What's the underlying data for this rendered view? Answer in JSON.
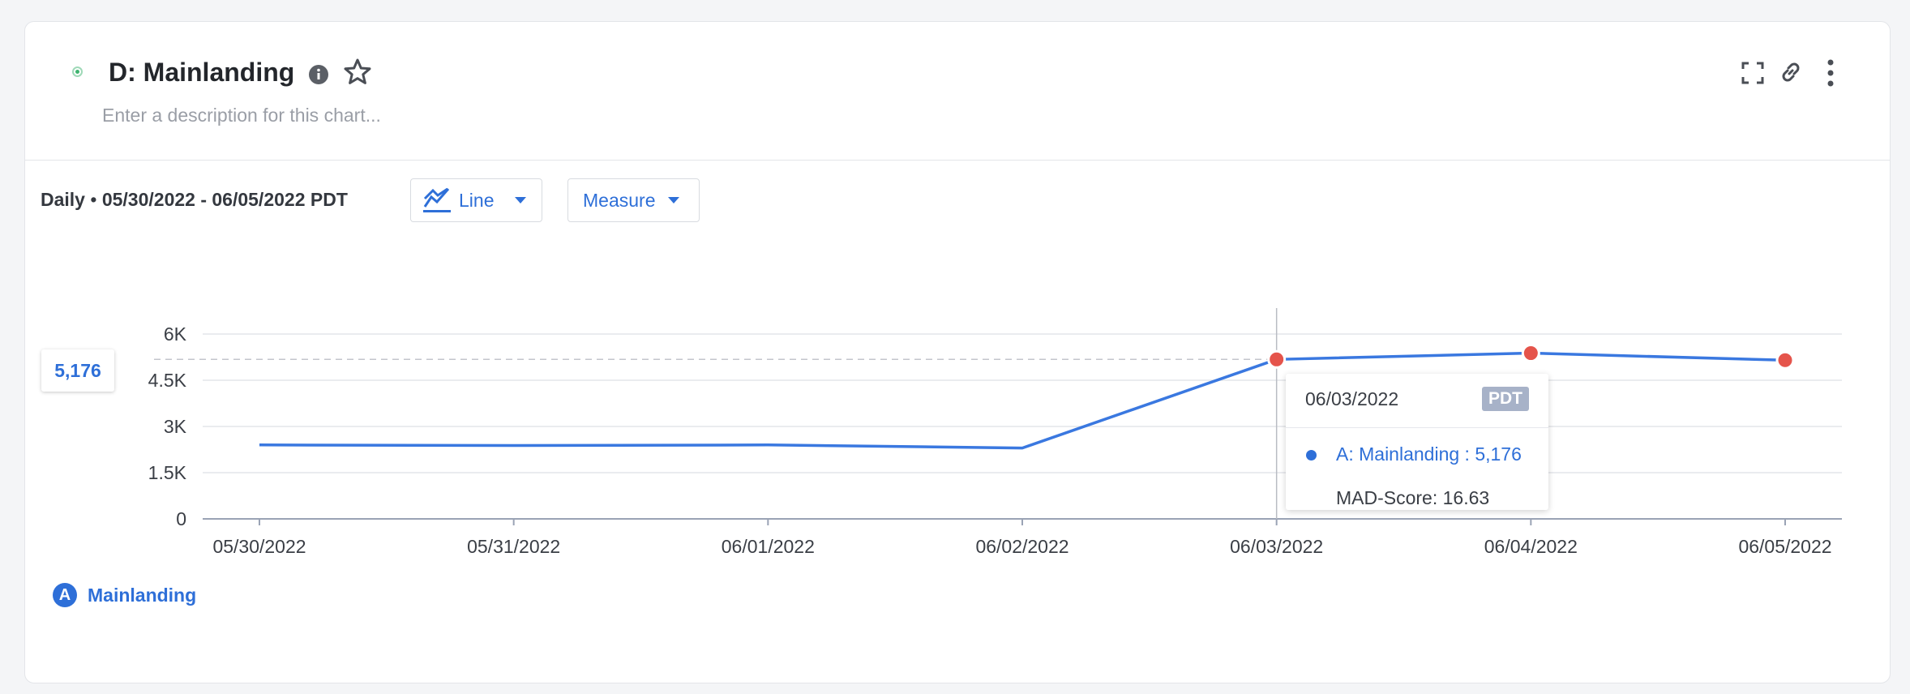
{
  "header": {
    "title": "D: Mainlanding",
    "description_placeholder": "Enter a description for this chart..."
  },
  "controls": {
    "granularity": "Daily",
    "separator": "•",
    "date_range": "05/30/2022 - 06/05/2022 PDT",
    "chart_type_label": "Line",
    "measure_label": "Measure"
  },
  "icons": {
    "status": "status-dot-icon",
    "info": "info-icon",
    "favorite": "star-icon",
    "expand": "expand-icon",
    "link": "link-icon",
    "more": "more-vertical-icon",
    "chart_type": "line-chart-icon"
  },
  "colors": {
    "accent": "#2e6fd8",
    "series_line": "#3a78e0",
    "anomaly_point": "#e5544b",
    "status": "#3fb46f",
    "tooltip_tz_badge": "#a7b2c8"
  },
  "hover_value_label": "5,176",
  "tooltip": {
    "date": "06/03/2022",
    "tz": "PDT",
    "series_text": "A: Mainlanding : 5,176",
    "score_text": "MAD-Score: 16.63"
  },
  "legend": {
    "badge": "A",
    "label": "Mainlanding"
  },
  "chart_data": {
    "type": "line",
    "x": [
      "05/30/2022",
      "05/31/2022",
      "06/01/2022",
      "06/02/2022",
      "06/03/2022",
      "06/04/2022",
      "06/05/2022"
    ],
    "series": [
      {
        "name": "Mainlanding",
        "values": [
          2400,
          2380,
          2400,
          2300,
          5176,
          5380,
          5150
        ]
      }
    ],
    "anomalies": [
      "06/03/2022",
      "06/04/2022",
      "06/05/2022"
    ],
    "ylim": [
      0,
      6000
    ],
    "yticks": [
      0,
      1500,
      3000,
      4500,
      6000
    ],
    "ytick_labels": [
      "0",
      "1.5K",
      "3K",
      "4.5K",
      "6K"
    ],
    "hover_x": "06/03/2022",
    "hover_value": 5176,
    "grid": true,
    "legend_position": "bottom-left"
  }
}
